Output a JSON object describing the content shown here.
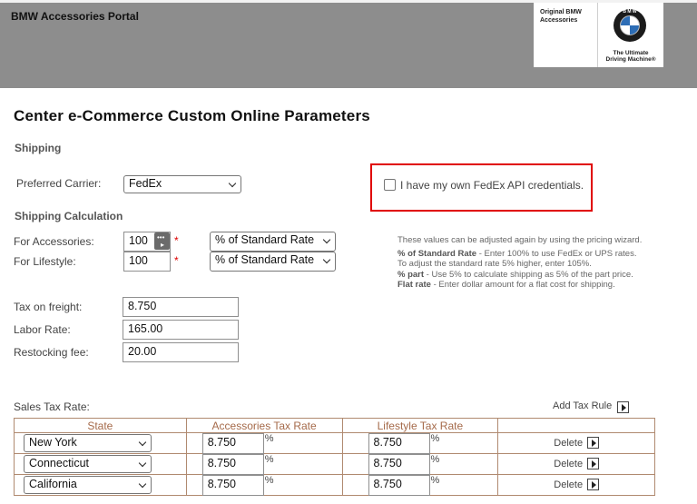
{
  "header": {
    "portal_title": "BMW Accessories Portal",
    "logo_text_line1": "Original BMW",
    "logo_text_line2": "Accessories",
    "roundel_letters": "B M W",
    "tagline_line1": "The Ultimate",
    "tagline_line2": "Driving Machine®"
  },
  "page_title": "Center e-Commerce Custom Online Parameters",
  "shipping": {
    "section_label": "Shipping",
    "preferred_carrier_label": "Preferred Carrier:",
    "preferred_carrier_value": "FedEx",
    "fedex_checkbox_label": "I have my own FedEx API credentials.",
    "fedex_checkbox_checked": false
  },
  "shipping_calc": {
    "section_label": "Shipping Calculation",
    "accessories_label": "For Accessories:",
    "accessories_value": "100",
    "accessories_method": "% of Standard Rate",
    "lifestyle_label": "For Lifestyle:",
    "lifestyle_value": "100",
    "lifestyle_method": "% of Standard Rate",
    "required_marker": "*",
    "notes": {
      "intro": "These values can be adjusted again by using the pricing wizard.",
      "standard_title": "% of Standard Rate",
      "standard_text": " - Enter 100% to use FedEx or UPS rates.",
      "standard_text2": "To adjust the standard rate 5% higher, enter 105%.",
      "part_title": "% part",
      "part_text": " - Use 5% to calculate shipping as 5% of the part price.",
      "flat_title": "Flat rate",
      "flat_text": " - Enter dollar amount for a flat cost for shipping."
    }
  },
  "fees": {
    "tax_on_freight_label": "Tax on freight:",
    "tax_on_freight_value": "8.750",
    "labor_rate_label": "Labor Rate:",
    "labor_rate_value": "165.00",
    "restocking_fee_label": "Restocking fee:",
    "restocking_fee_value": "20.00"
  },
  "sales_tax": {
    "label": "Sales Tax Rate:",
    "add_rule_label": "Add Tax Rule",
    "columns": [
      "State",
      "Accessories Tax Rate",
      "Lifestyle Tax Rate",
      ""
    ],
    "percent_sign": "%",
    "delete_label": "Delete",
    "rows": [
      {
        "state": "New York",
        "accessories_rate": "8.750",
        "lifestyle_rate": "8.750"
      },
      {
        "state": "Connecticut",
        "accessories_rate": "8.750",
        "lifestyle_rate": "8.750"
      },
      {
        "state": "California",
        "accessories_rate": "8.750",
        "lifestyle_rate": "8.750"
      }
    ]
  },
  "colors": {
    "header_bg": "#8d8d8d",
    "highlight_border": "#e00000",
    "table_header_text": "#a56a4a",
    "required_red": "#d00000"
  }
}
